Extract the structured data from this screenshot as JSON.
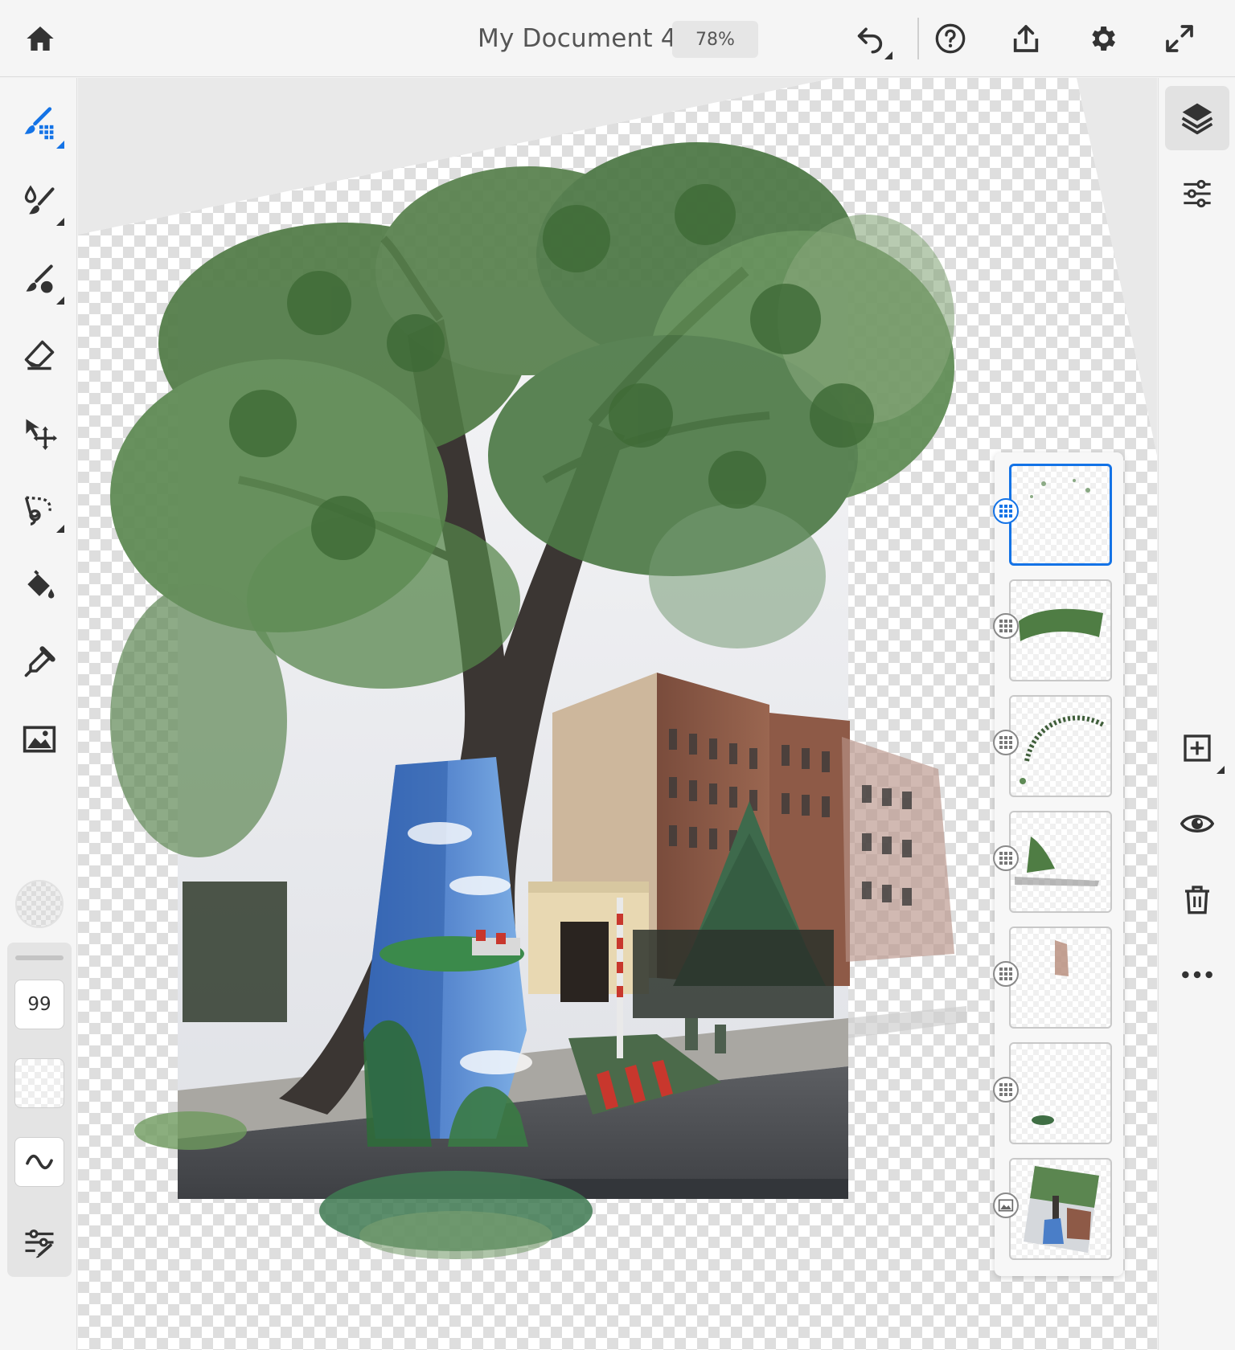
{
  "app": {
    "document_title": "My Document 4",
    "zoom_level": "78%",
    "accent_color": "#1473e6"
  },
  "topbar": {
    "icons": [
      "home-icon",
      "undo-icon",
      "help-icon",
      "share-icon",
      "settings-icon",
      "fullscreen-icon"
    ]
  },
  "left_toolbar": {
    "tools": [
      "pixel-brush-icon",
      "live-brush-icon",
      "vector-brush-icon",
      "eraser-icon",
      "move-icon",
      "lasso-icon",
      "fill-icon",
      "eyedropper-icon",
      "image-icon"
    ],
    "active_tool": "pixel-brush-icon",
    "brush_size": "99",
    "brush_settings_icons": [
      "opacity-swatch",
      "smoothing-icon",
      "brush-settings-icon"
    ]
  },
  "right_toolbar": {
    "icons": [
      "layers-icon",
      "layer-properties-icon",
      "add-layer-icon",
      "visibility-icon",
      "delete-icon",
      "more-icon"
    ]
  },
  "layers": {
    "count": 7,
    "selected_index": 0,
    "items": [
      {
        "type": "pixel"
      },
      {
        "type": "pixel"
      },
      {
        "type": "pixel"
      },
      {
        "type": "pixel"
      },
      {
        "type": "pixel"
      },
      {
        "type": "pixel"
      },
      {
        "type": "image"
      }
    ]
  }
}
